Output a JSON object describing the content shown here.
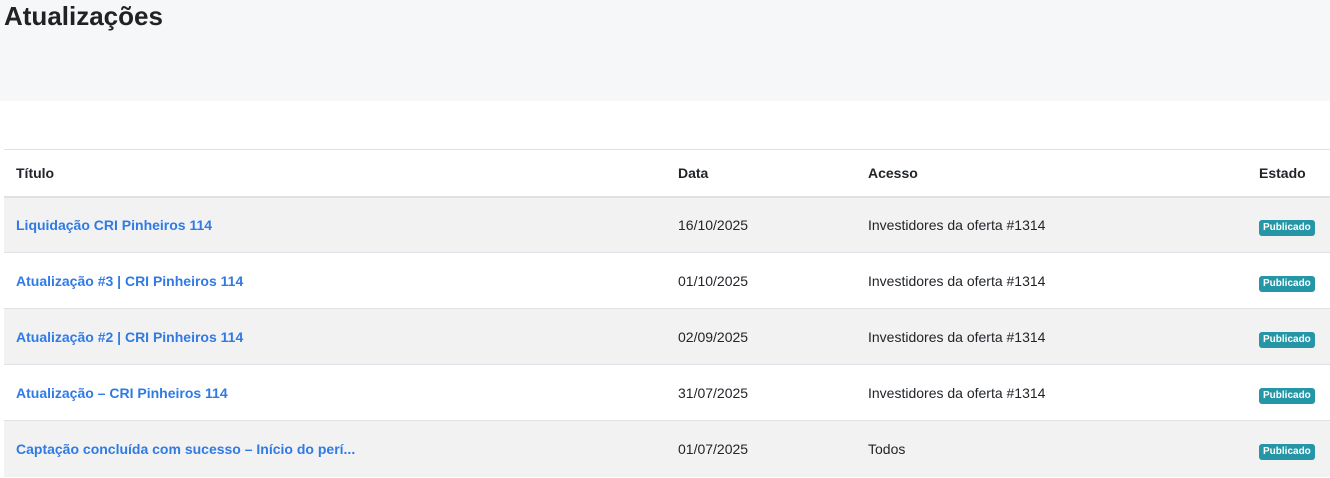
{
  "page": {
    "title": "Atualizações"
  },
  "table": {
    "headers": {
      "title": "Título",
      "date": "Data",
      "access": "Acesso",
      "state": "Estado"
    },
    "rows": [
      {
        "title": "Liquidação CRI Pinheiros 114",
        "date": "16/10/2025",
        "access": "Investidores da oferta #1314",
        "state": "Publicado"
      },
      {
        "title": "Atualização #3 | CRI Pinheiros 114",
        "date": "01/10/2025",
        "access": "Investidores da oferta #1314",
        "state": "Publicado"
      },
      {
        "title": "Atualização #2 | CRI Pinheiros 114",
        "date": "02/09/2025",
        "access": "Investidores da oferta #1314",
        "state": "Publicado"
      },
      {
        "title": "Atualização – CRI Pinheiros 114",
        "date": "31/07/2025",
        "access": "Investidores da oferta #1314",
        "state": "Publicado"
      },
      {
        "title": "Captação concluída com sucesso – Início do perí...",
        "date": "01/07/2025",
        "access": "Todos",
        "state": "Publicado"
      }
    ]
  },
  "colors": {
    "link": "#2f7ae5",
    "badge": "#2596a6",
    "header_bg": "#f6f7f9",
    "stripe": "#f2f2f2"
  }
}
